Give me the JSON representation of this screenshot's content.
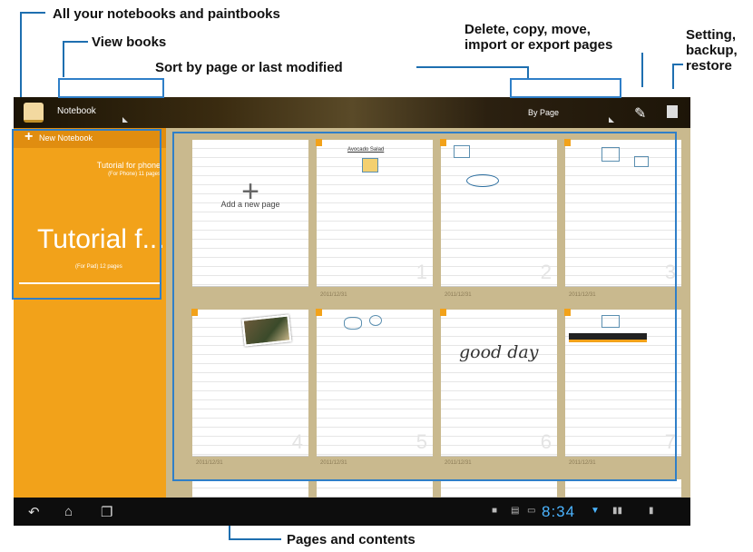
{
  "callouts": {
    "all_books": "All your notebooks and paintbooks",
    "view_books": "View books",
    "sort": "Sort by page or last modified",
    "delete_copy_1": "Delete, copy, move,",
    "delete_copy_2": "import or export pages",
    "setting_1": "Setting,",
    "setting_2": "backup,",
    "setting_3": "restore",
    "pages_contents": "Pages and contents"
  },
  "topbar": {
    "view_select": "Notebook",
    "sort_select": "By Page"
  },
  "sidebar": {
    "new_notebook": "New Notebook",
    "notebooks": [
      {
        "title": "Tutorial for phone",
        "meta": "(For Phone)  11 pages"
      },
      {
        "title": "Tutorial f...",
        "meta": "(For Pad)  12 pages"
      }
    ]
  },
  "pages": {
    "add_label": "Add a new page",
    "add_symbol": "+",
    "items": [
      {
        "num": "1",
        "date": "2011/12/31"
      },
      {
        "num": "2",
        "date": "2011/12/31"
      },
      {
        "num": "3",
        "date": "2011/12/31"
      },
      {
        "num": "4",
        "date": "2011/12/31"
      },
      {
        "num": "5",
        "date": "2011/12/31"
      },
      {
        "num": "6",
        "date": "2011/12/31"
      },
      {
        "num": "7",
        "date": "2011/12/31"
      }
    ],
    "handwriting": "good day",
    "sketch_title": "Avocado Salad"
  },
  "statusbar": {
    "clock": "8:34"
  },
  "icons": {
    "app": "notebook-app-icon",
    "edit": "pencil-icon",
    "menu": "menu-icon",
    "back": "back-icon",
    "home": "home-icon",
    "recent": "recent-apps-icon"
  },
  "colors": {
    "accent_orange": "#f2a21a",
    "callout_blue": "#2f7fc8",
    "clock_blue": "#4bb4ff"
  }
}
